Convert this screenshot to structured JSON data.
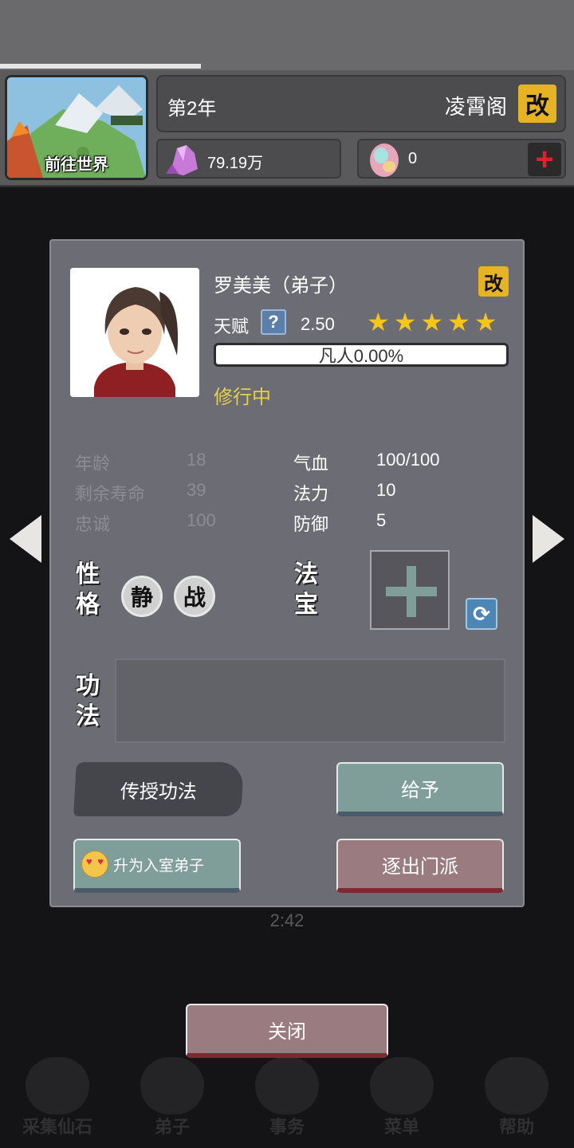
{
  "world": {
    "label": "前往世界"
  },
  "header": {
    "year": "第2年",
    "sect": "凌霄阁",
    "edit_glyph": "改"
  },
  "resources": {
    "spirit_stones": "79.19万",
    "gems": "0",
    "plus_glyph": "+"
  },
  "disciple": {
    "name": "罗美美（弟子）",
    "edit_glyph": "改",
    "talent_label": "天赋",
    "help_glyph": "?",
    "talent_value": "2.50",
    "stars": 5,
    "cultivation": "凡人0.00%",
    "cultivation_progress": 0.0,
    "status": "修行中"
  },
  "attributes": {
    "left": [
      {
        "label": "年龄",
        "value": "18"
      },
      {
        "label": "剩余寿命",
        "value": "39"
      },
      {
        "label": "忠诚",
        "value": "100"
      }
    ],
    "right": [
      {
        "label": "气血",
        "value": "100/100"
      },
      {
        "label": "法力",
        "value": "10"
      },
      {
        "label": "防御",
        "value": "5"
      }
    ]
  },
  "personality": {
    "title_1": "性",
    "title_2": "格",
    "traits": [
      "静",
      "战"
    ]
  },
  "treasure": {
    "title_1": "法",
    "title_2": "宝"
  },
  "skills": {
    "title_1": "功",
    "title_2": "法"
  },
  "actions": {
    "teach": "传授功法",
    "give": "给予",
    "promote": "升为入室弟子",
    "expel": "逐出门派",
    "close": "关闭"
  },
  "background": {
    "time": "2:42",
    "nav": [
      "采集仙石",
      "弟子",
      "事务",
      "菜单",
      "帮助"
    ]
  },
  "colors": {
    "modal_bg": "#6c6c74",
    "star": "#f5c518",
    "status": "#e6d04a",
    "edit_badge": "#e6b324",
    "teal_button": "#7f9e9a",
    "rose_button": "#9a7b80"
  }
}
